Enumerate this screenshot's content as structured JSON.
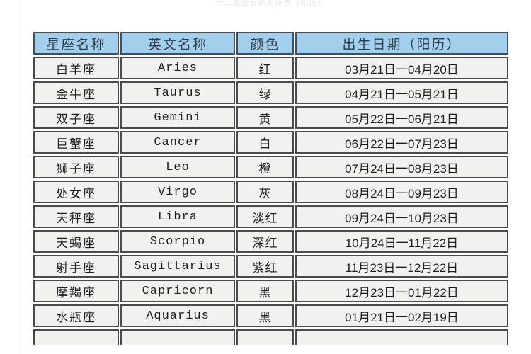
{
  "top_caption": "十二星座日期对照表（阳历）",
  "table": {
    "headers": {
      "name": "星座名称",
      "english": "英文名称",
      "color": "颜色",
      "date": "出生日期（阳历）"
    },
    "header_bg": "#a3cfee",
    "cell_bg": "#f2f1ee",
    "border_color": "#4b4b4b",
    "rows": [
      {
        "name": "白羊座",
        "english": "Aries",
        "color": "红",
        "date": "03月21日一04月20日"
      },
      {
        "name": "金牛座",
        "english": "Taurus",
        "color": "绿",
        "date": "04月21日一05月21日"
      },
      {
        "name": "双子座",
        "english": "Gemini",
        "color": "黄",
        "date": "05月22日一06月21日"
      },
      {
        "name": "巨蟹座",
        "english": "Cancer",
        "color": "白",
        "date": "06月22日一07月23日"
      },
      {
        "name": "狮子座",
        "english": "Leo",
        "color": "橙",
        "date": "07月24日一08月23日"
      },
      {
        "name": "处女座",
        "english": "Virgo",
        "color": "灰",
        "date": "08月24日一09月23日"
      },
      {
        "name": "天秤座",
        "english": "Libra",
        "color": "淡红",
        "date": "09月24日一10月23日"
      },
      {
        "name": "天蝎座",
        "english": "Scorpio",
        "color": "深红",
        "date": "10月24日一11月22日"
      },
      {
        "name": "射手座",
        "english": "Sagittarius",
        "color": "紫红",
        "date": "11月23日一12月22日"
      },
      {
        "name": "摩羯座",
        "english": "Capricorn",
        "color": "黑",
        "date": "12月23日一01月22日"
      },
      {
        "name": "水瓶座",
        "english": "Aquarius",
        "color": "黑",
        "date": "01月21日一02月19日"
      }
    ]
  }
}
